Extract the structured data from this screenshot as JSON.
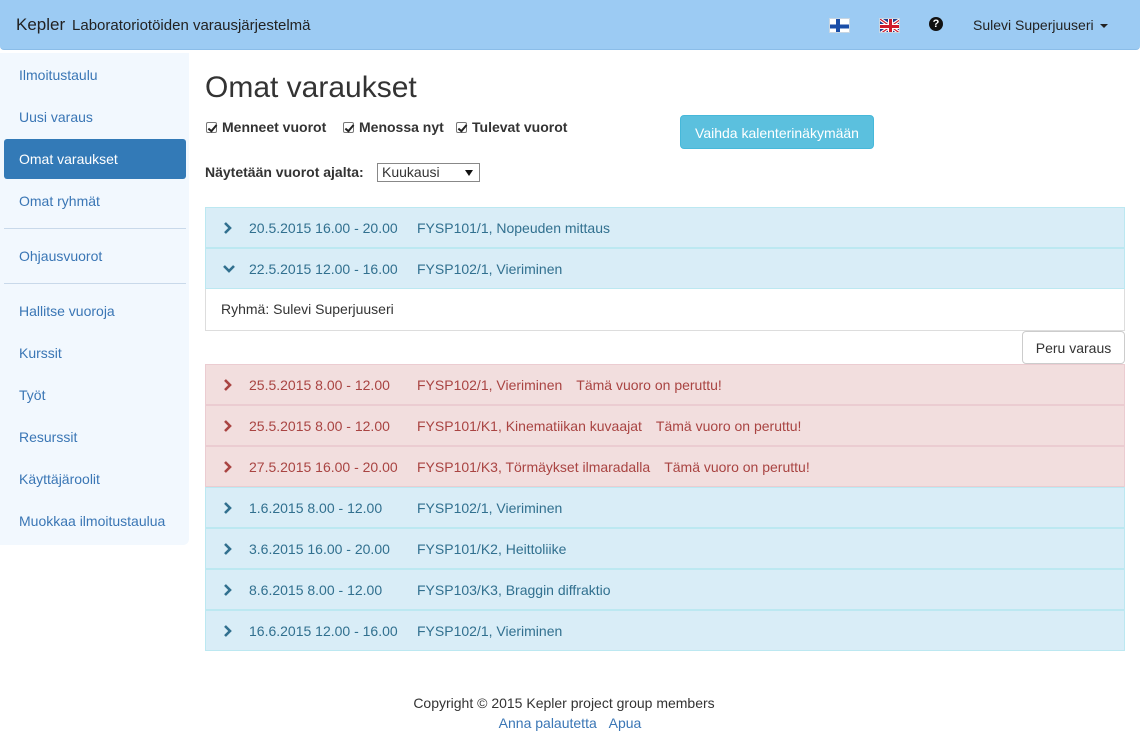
{
  "navbar": {
    "brand_name": "Kepler",
    "brand_subtitle": "Laboratoriotöiden varausjärjestelmä",
    "user_name": "Sulevi Superjuuseri",
    "help_glyph": "?"
  },
  "sidebar": {
    "items": [
      {
        "label": "Ilmoitustaulu",
        "active": false
      },
      {
        "label": "Uusi varaus",
        "active": false
      },
      {
        "label": "Omat varaukset",
        "active": true
      },
      {
        "label": "Omat ryhmät",
        "active": false
      },
      {
        "label": "Ohjausvuorot",
        "active": false
      },
      {
        "label": "Hallitse vuoroja",
        "active": false
      },
      {
        "label": "Kurssit",
        "active": false
      },
      {
        "label": "Työt",
        "active": false
      },
      {
        "label": "Resurssit",
        "active": false
      },
      {
        "label": "Käyttäjäroolit",
        "active": false
      },
      {
        "label": "Muokkaa ilmoitustaulua",
        "active": false
      }
    ]
  },
  "main": {
    "title": "Omat varaukset",
    "filters": [
      {
        "label": "Menneet vuorot",
        "checked": true
      },
      {
        "label": "Menossa nyt",
        "checked": true
      },
      {
        "label": "Tulevat vuorot",
        "checked": true
      }
    ],
    "calendar_button": "Vaihda kalenterinäkymään",
    "range_label": "Näytetään vuorot ajalta:",
    "range_value": "Kuukausi",
    "reservations": [
      {
        "date": "20.5.2015 16.00 - 20.00",
        "course": "FYSP101/1, Nopeuden mittaus",
        "note": "",
        "status": "info",
        "expanded": false
      },
      {
        "date": "22.5.2015 12.00 - 16.00",
        "course": "FYSP102/1, Vieriminen",
        "note": "",
        "status": "info",
        "expanded": true
      },
      {
        "date": "25.5.2015 8.00 - 12.00",
        "course": "FYSP102/1, Vieriminen",
        "note": "Tämä vuoro on peruttu!",
        "status": "danger",
        "expanded": false
      },
      {
        "date": "25.5.2015 8.00 - 12.00",
        "course": "FYSP101/K1, Kinematiikan kuvaajat",
        "note": "Tämä vuoro on peruttu!",
        "status": "danger",
        "expanded": false
      },
      {
        "date": "27.5.2015 16.00 - 20.00",
        "course": "FYSP101/K3, Törmäykset ilmaradalla",
        "note": "Tämä vuoro on peruttu!",
        "status": "danger",
        "expanded": false
      },
      {
        "date": "1.6.2015 8.00 - 12.00",
        "course": "FYSP102/1, Vieriminen",
        "note": "",
        "status": "info",
        "expanded": false
      },
      {
        "date": "3.6.2015 16.00 - 20.00",
        "course": "FYSP101/K2, Heittoliike",
        "note": "",
        "status": "info",
        "expanded": false
      },
      {
        "date": "8.6.2015 8.00 - 12.00",
        "course": "FYSP103/K3, Braggin diffraktio",
        "note": "",
        "status": "info",
        "expanded": false
      },
      {
        "date": "16.6.2015 12.00 - 16.00",
        "course": "FYSP102/1, Vieriminen",
        "note": "",
        "status": "info",
        "expanded": false
      }
    ],
    "expanded_detail": "Ryhmä: Sulevi Superjuuseri",
    "cancel_button": "Peru varaus"
  },
  "footer": {
    "copyright": "Copyright © 2015 Kepler project group members",
    "links": [
      "Anna palautetta",
      "Apua"
    ]
  },
  "colors": {
    "navbar": "#9ccbf3",
    "sidebar": "#f2f8fe",
    "active": "#337ab7",
    "info_row": "#d9edf7",
    "danger_row": "#f2dede",
    "calendar_button": "#5bc0de"
  },
  "icons": {
    "fi_flag": "finland-flag-icon",
    "uk_flag": "uk-flag-icon",
    "help": "question-circle-icon",
    "collapsed": "chevron-right-icon",
    "expanded": "chevron-down-icon"
  }
}
